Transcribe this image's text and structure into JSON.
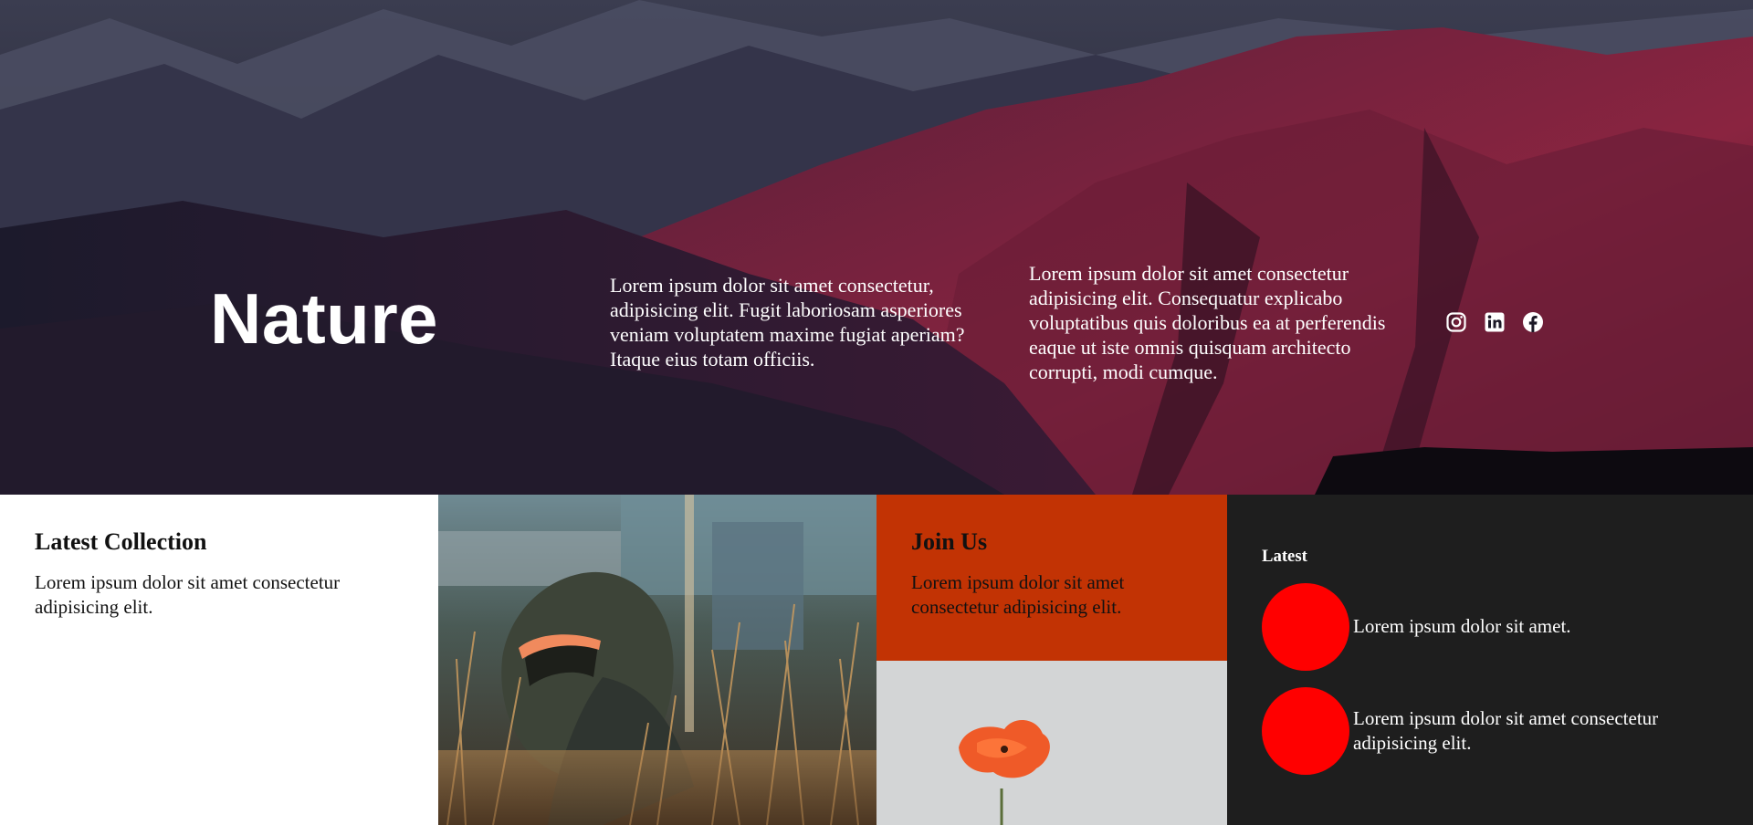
{
  "hero": {
    "title": "Nature",
    "paragraph_one": "Lorem ipsum dolor sit amet consectetur, adipisicing elit. Fugit laboriosam asperiores veniam voluptatem maxime fugiat aperiam? Itaque eius totam officiis.",
    "paragraph_two": "Lorem ipsum dolor sit amet consectetur adipisicing elit. Consequatur explicabo voluptatibus quis doloribus ea at perferendis eaque ut iste omnis quisquam architecto corrupti, modi cumque.",
    "socials": [
      {
        "icon": "instagram-icon"
      },
      {
        "icon": "linkedin-icon"
      },
      {
        "icon": "facebook-icon"
      }
    ]
  },
  "latest_collection": {
    "heading": "Latest Collection",
    "text": "Lorem ipsum dolor sit amet consectetur adipisicing elit."
  },
  "join_us": {
    "heading": "Join Us",
    "text": "Lorem ipsum dolor sit amet consectetur adipisicing elit."
  },
  "latest": {
    "heading": "Latest",
    "items": [
      {
        "text": "Lorem ipsum dolor sit amet."
      },
      {
        "text": "Lorem ipsum dolor sit amet consectetur adipisicing elit."
      }
    ]
  },
  "colors": {
    "join_bg": "#c23304",
    "dot": "#ff0000",
    "dark_bg": "#1e1e1e"
  }
}
